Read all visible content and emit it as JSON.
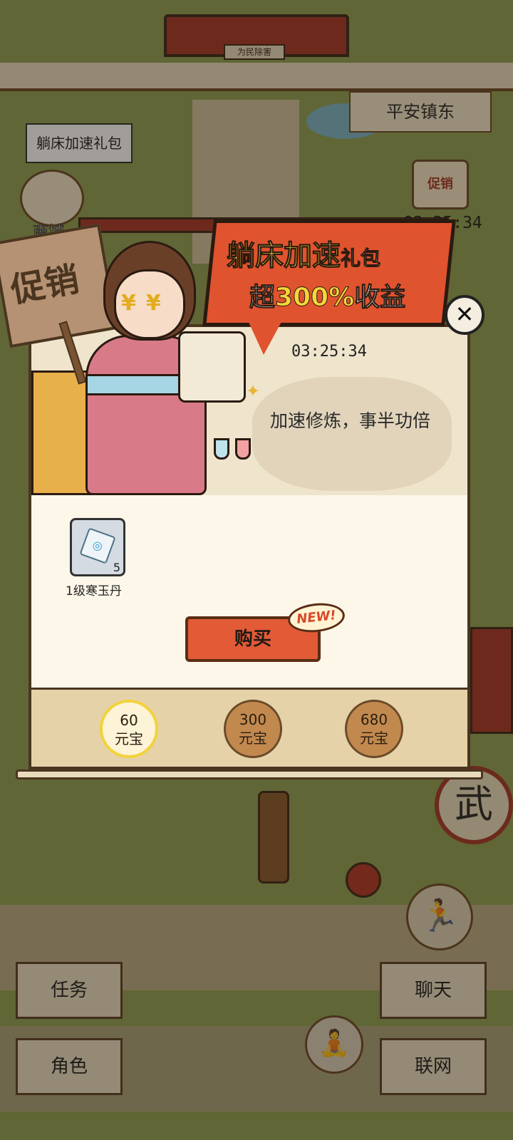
{
  "scene": {
    "plaque": "为民除害",
    "location": "平安镇东",
    "gift_tip": "躺床加速礼包",
    "shop_label": "商城",
    "promo_mini": "促销",
    "top_timer": "03:25:34",
    "wu_sign": "武"
  },
  "modal": {
    "banner_line1_main": "躺床加速",
    "banner_line1_small": "礼包",
    "banner_line2_prefix": "超",
    "banner_line2_highlight": "300%",
    "banner_line2_suffix": "收益",
    "countdown": "03:25:34",
    "slogan": "加速修炼，事半功倍",
    "sign_text": "促销",
    "item": {
      "name": "1级寒玉丹",
      "count": "5",
      "icon": "pill-icon"
    },
    "buy_label": "购买",
    "new_badge": "NEW!",
    "close_glyph": "✕",
    "tiers": [
      {
        "amount": "60",
        "unit": "元宝",
        "selected": true
      },
      {
        "amount": "300",
        "unit": "元宝",
        "selected": false
      },
      {
        "amount": "680",
        "unit": "元宝",
        "selected": false
      }
    ]
  },
  "controls": {
    "task": "任务",
    "role": "角色",
    "chat": "聊天",
    "network": "联网",
    "run_icon": "run-icon",
    "meditate_icon": "meditate-icon"
  },
  "colors": {
    "accent_red": "#e0532f",
    "gold": "#f5d53b",
    "parchment": "#efe4cc"
  }
}
